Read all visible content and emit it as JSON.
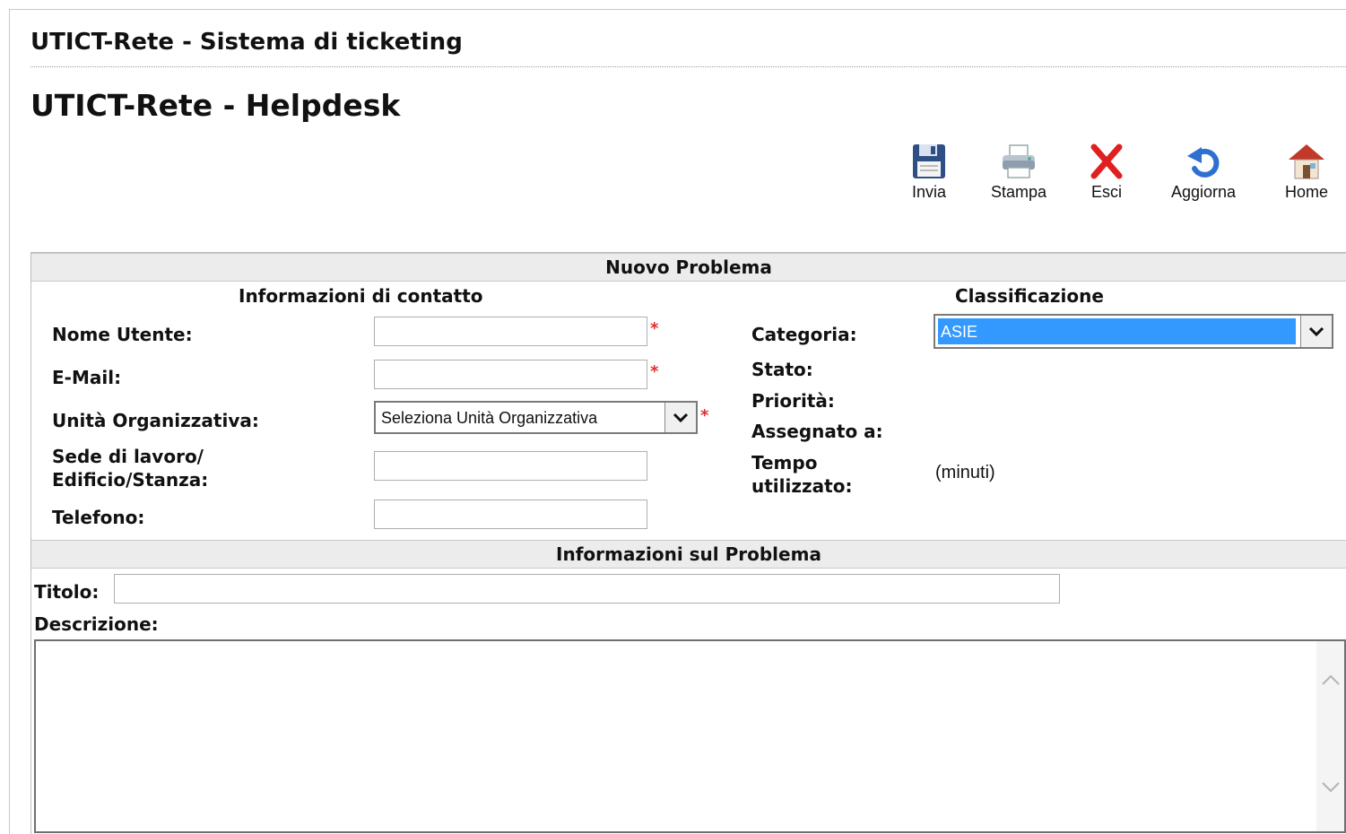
{
  "header": {
    "app_title": "UTICT-Rete - Sistema di ticketing",
    "page_title": "UTICT-Rete - Helpdesk"
  },
  "toolbar": {
    "invia": "Invia",
    "stampa": "Stampa",
    "esci": "Esci",
    "aggiorna": "Aggiorna",
    "home": "Home"
  },
  "form": {
    "section_title": "Nuovo Problema",
    "contact": {
      "heading": "Informazioni di contatto",
      "nome_utente_label": "Nome Utente:",
      "nome_utente_value": "",
      "email_label": "E-Mail:",
      "email_value": "",
      "unita_label": "Unità Organizzativa:",
      "unita_selected": "Seleziona Unità Organizzativa",
      "sede_label_line1": "Sede di lavoro/",
      "sede_label_line2": "Edificio/Stanza:",
      "sede_value": "",
      "telefono_label": "Telefono:",
      "telefono_value": "",
      "required_marker": "*"
    },
    "classification": {
      "heading": "Classificazione",
      "categoria_label": "Categoria:",
      "categoria_selected": "ASIE",
      "stato_label": "Stato:",
      "priorita_label": "Priorità:",
      "assegnato_label": "Assegnato a:",
      "tempo_label_line1": "Tempo",
      "tempo_label_line2": "utilizzato:",
      "tempo_unit": "(minuti)"
    },
    "problem": {
      "section_title": "Informazioni sul Problema",
      "titolo_label": "Titolo:",
      "titolo_value": "",
      "descrizione_label": "Descrizione:",
      "descrizione_value": ""
    }
  },
  "colors": {
    "selected_highlight": "#3399ff",
    "required": "#e03030",
    "section_bar": "#ececec",
    "exit_red": "#e02020",
    "refresh_blue": "#2f6fd0",
    "save_blue": "#2e4f86",
    "home_roof": "#c0392b"
  },
  "icons": {
    "invia": "floppy-disk-icon",
    "stampa": "printer-icon",
    "esci": "red-x-icon",
    "aggiorna": "refresh-arrow-icon",
    "home": "house-icon"
  }
}
